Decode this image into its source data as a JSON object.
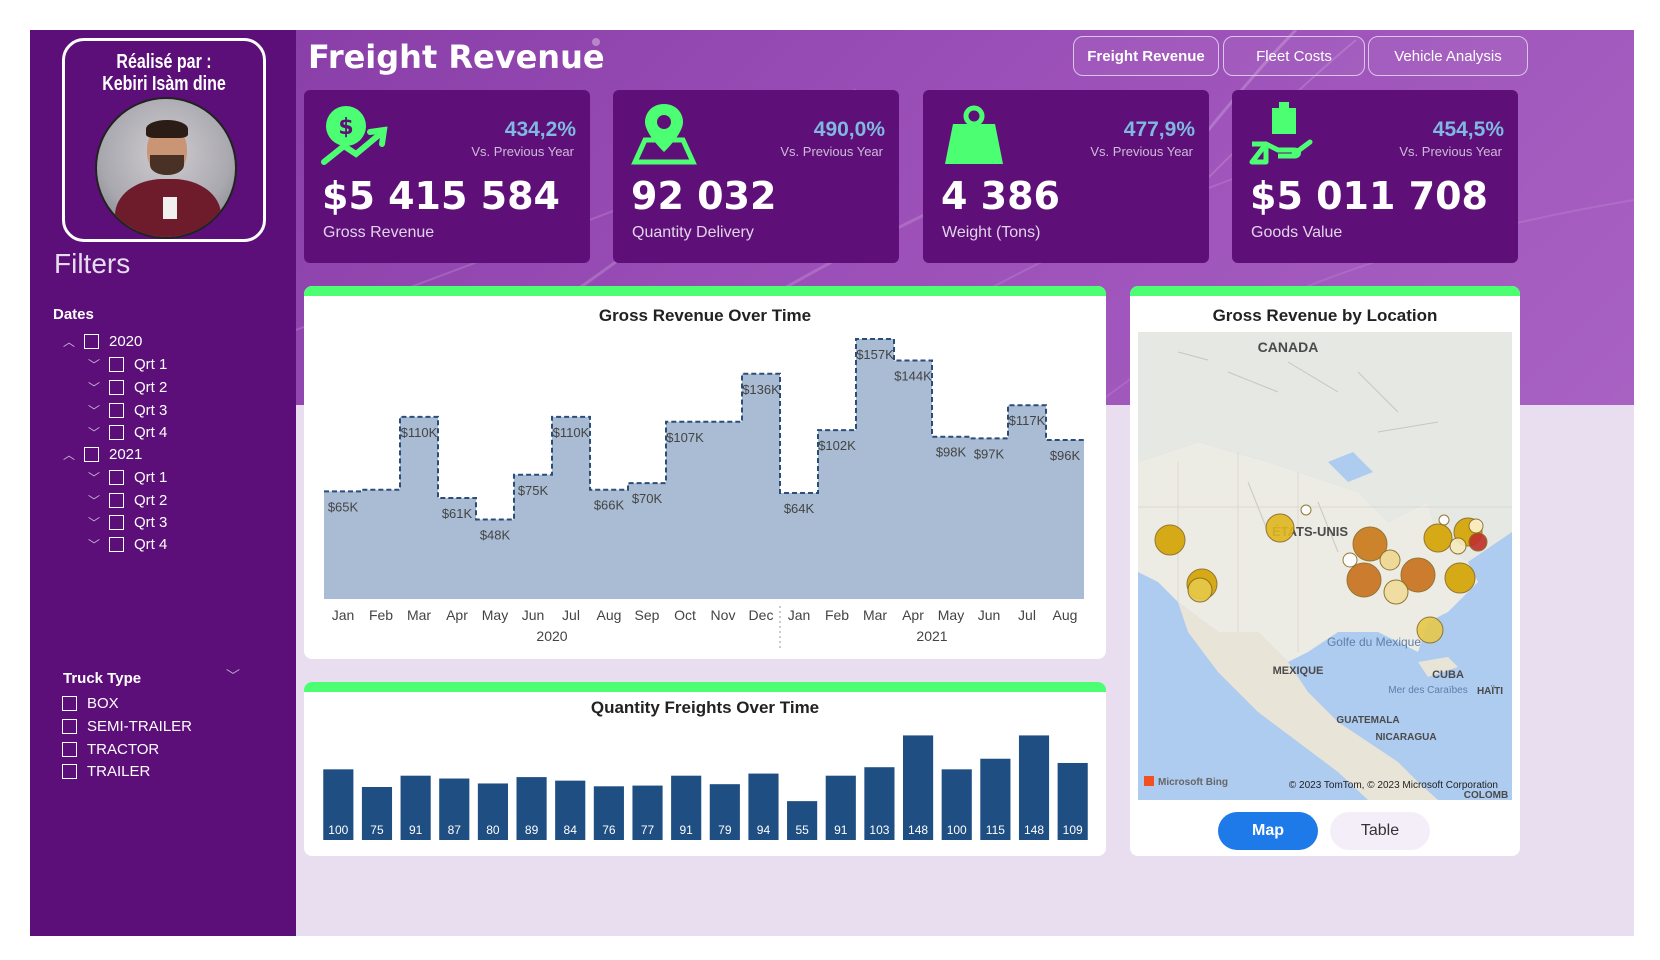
{
  "profile": {
    "made_by_line1": "Réalisé par :",
    "made_by_line2": "Kebiri Isàm dine"
  },
  "filters": {
    "title": "Filters",
    "dates_label": "Dates",
    "years": [
      {
        "label": "2020",
        "quarters": [
          "Qrt 1",
          "Qrt 2",
          "Qrt 3",
          "Qrt 4"
        ]
      },
      {
        "label": "2021",
        "quarters": [
          "Qrt 1",
          "Qrt 2",
          "Qrt 3",
          "Qrt 4"
        ]
      }
    ],
    "truck_type_label": "Truck Type",
    "truck_types": [
      "BOX",
      "SEMI-TRAILER",
      "TRACTOR",
      "TRAILER"
    ]
  },
  "header": {
    "title": "Freight Revenue",
    "tabs": [
      "Freight Revenue",
      "Fleet Costs",
      "Vehicle Analysis"
    ],
    "active_tab": "Freight Revenue"
  },
  "kpis": [
    {
      "icon": "dollar-growth-icon",
      "pct": "434,2%",
      "vs": "Vs. Previous Year",
      "value": "$5 415 584",
      "label": "Gross Revenue"
    },
    {
      "icon": "map-pin-icon",
      "pct": "490,0%",
      "vs": "Vs. Previous Year",
      "value": "92 032",
      "label": "Quantity Delivery"
    },
    {
      "icon": "weight-icon",
      "pct": "477,9%",
      "vs": "Vs. Previous Year",
      "value": "4 386",
      "label": "Weight (Tons)"
    },
    {
      "icon": "hand-package-icon",
      "pct": "454,5%",
      "vs": "Vs. Previous Year",
      "value": "$5 011 708",
      "label": "Goods Value"
    }
  ],
  "colors": {
    "accent": "#4cff72",
    "sidebar": "#5c0f78",
    "kpi_bg": "#5f1078",
    "area_fill": "#a9bcd4",
    "bar_fill": "#1f4e82",
    "map_active": "#1e7ae8"
  },
  "chart_data": [
    {
      "type": "area",
      "title": "Gross Revenue Over Time",
      "categories": [
        "Jan",
        "Feb",
        "Mar",
        "Apr",
        "May",
        "Jun",
        "Jul",
        "Aug",
        "Sep",
        "Oct",
        "Nov",
        "Dec",
        "Jan",
        "Feb",
        "Mar",
        "Apr",
        "May",
        "Jun",
        "Jul",
        "Aug"
      ],
      "groups": [
        {
          "label": "2020",
          "count": 12
        },
        {
          "label": "2021",
          "count": 8
        }
      ],
      "values": [
        65,
        66,
        110,
        61,
        48,
        75,
        110,
        66,
        70,
        107,
        107,
        136,
        64,
        102,
        157,
        144,
        98,
        97,
        117,
        96
      ],
      "labels": [
        "$65K",
        "",
        "$110K",
        "$61K",
        "$48K",
        "$75K",
        "$110K",
        "$66K",
        "$70K",
        "$107K",
        "",
        "$136K",
        "$64K",
        "$102K",
        "$157K",
        "$144K",
        "$98K",
        "$97K",
        "$117K",
        "$96K"
      ],
      "unit": "K",
      "ylim": [
        0,
        160
      ]
    },
    {
      "type": "bar",
      "title": "Quantity Freights Over Time",
      "values": [
        100,
        75,
        91,
        87,
        80,
        89,
        84,
        76,
        77,
        91,
        79,
        94,
        55,
        91,
        103,
        148,
        100,
        115,
        148,
        109
      ],
      "ylim": [
        0,
        150
      ]
    },
    {
      "type": "map",
      "title": "Gross Revenue by Location",
      "labels": [
        "CANADA",
        "ÉTATS-UNIS",
        "MEXIQUE",
        "Golfe du Mexique",
        "CUBA",
        "HAÏTI",
        "Mer des Caraïbes",
        "GUATEMALA",
        "NICARAGUA",
        "COLOMB"
      ],
      "attribution": "© 2023 TomTom, © 2023 Microsoft Corporation",
      "provider": "Microsoft Bing",
      "view_options": [
        "Map",
        "Table"
      ],
      "active_view": "Map"
    }
  ]
}
